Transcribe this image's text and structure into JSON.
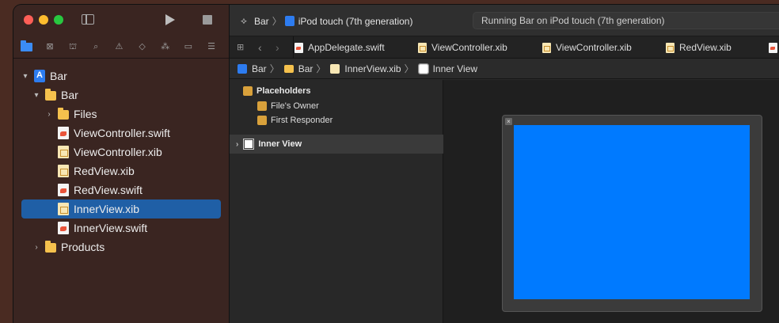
{
  "sidebar": {
    "tree": [
      {
        "label": "Bar",
        "icon": "project-icon",
        "disclosure": "▾",
        "level": 0
      },
      {
        "label": "Bar",
        "icon": "folder-icon",
        "disclosure": "▾",
        "level": 1
      },
      {
        "label": "Files",
        "icon": "folder-icon",
        "disclosure": "›",
        "level": 2
      },
      {
        "label": "ViewController.swift",
        "icon": "swift-file-icon",
        "disclosure": "",
        "level": 2
      },
      {
        "label": "ViewController.xib",
        "icon": "xib-file-icon",
        "disclosure": "",
        "level": 2
      },
      {
        "label": "RedView.xib",
        "icon": "xib-file-icon",
        "disclosure": "",
        "level": 2
      },
      {
        "label": "RedView.swift",
        "icon": "swift-file-icon",
        "disclosure": "",
        "level": 2
      },
      {
        "label": "InnerView.xib",
        "icon": "xib-file-icon",
        "disclosure": "",
        "level": 2,
        "selected": true
      },
      {
        "label": "InnerView.swift",
        "icon": "swift-file-icon",
        "disclosure": "",
        "level": 2
      },
      {
        "label": "Products",
        "icon": "folder-icon",
        "disclosure": "›",
        "level": 1
      }
    ]
  },
  "toolbar": {
    "scheme": "Bar",
    "destination": "iPod touch (7th generation)",
    "activity": "Running Bar on iPod touch (7th generation)"
  },
  "tabs": [
    {
      "label": "AppDelegate.swift",
      "icon": "swift-file-icon"
    },
    {
      "label": "ViewController.xib",
      "icon": "xib-file-icon"
    },
    {
      "label": "ViewController.xib",
      "icon": "xib-file-icon"
    },
    {
      "label": "RedView.xib",
      "icon": "xib-file-icon"
    }
  ],
  "jumpbar": {
    "project": "Bar",
    "group": "Bar",
    "file": "InnerView.xib",
    "object": "Inner View"
  },
  "outline": {
    "heading": "Placeholders",
    "items": [
      "File's Owner",
      "First Responder"
    ],
    "view_row": "Inner View"
  },
  "colors": {
    "accent": "#2d7cf0",
    "selection": "#1f5fa6",
    "canvas_view": "#007aff"
  }
}
